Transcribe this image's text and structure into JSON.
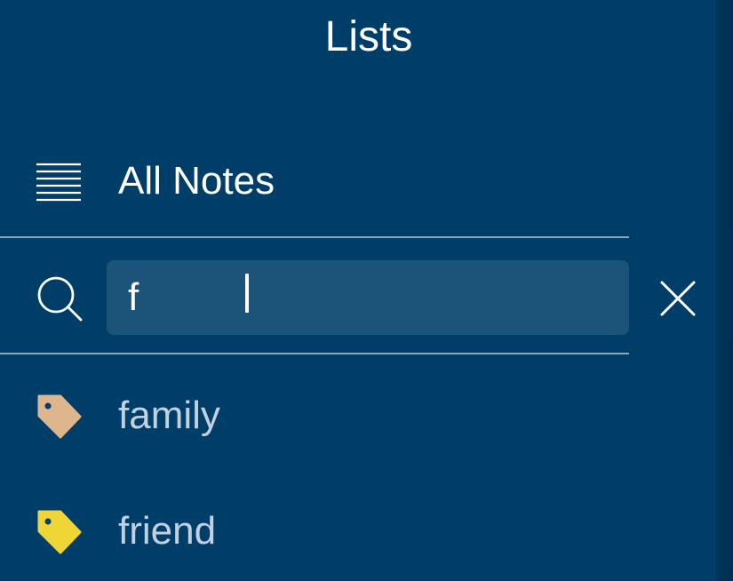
{
  "header": {
    "title": "Lists"
  },
  "all_notes": {
    "label": "All Notes",
    "icon": "list-lines-icon"
  },
  "search": {
    "icon": "search-icon",
    "value": "f",
    "clear_icon": "close-icon"
  },
  "tags": [
    {
      "label": "family",
      "color": "#deb68d",
      "icon": "tag-icon"
    },
    {
      "label": "friend",
      "color": "#f0d536",
      "icon": "tag-icon"
    }
  ],
  "colors": {
    "background": "#003e6a",
    "search_field": "#1b5478",
    "divider": "#8fa6bd",
    "tag_text": "#c3d1de"
  }
}
